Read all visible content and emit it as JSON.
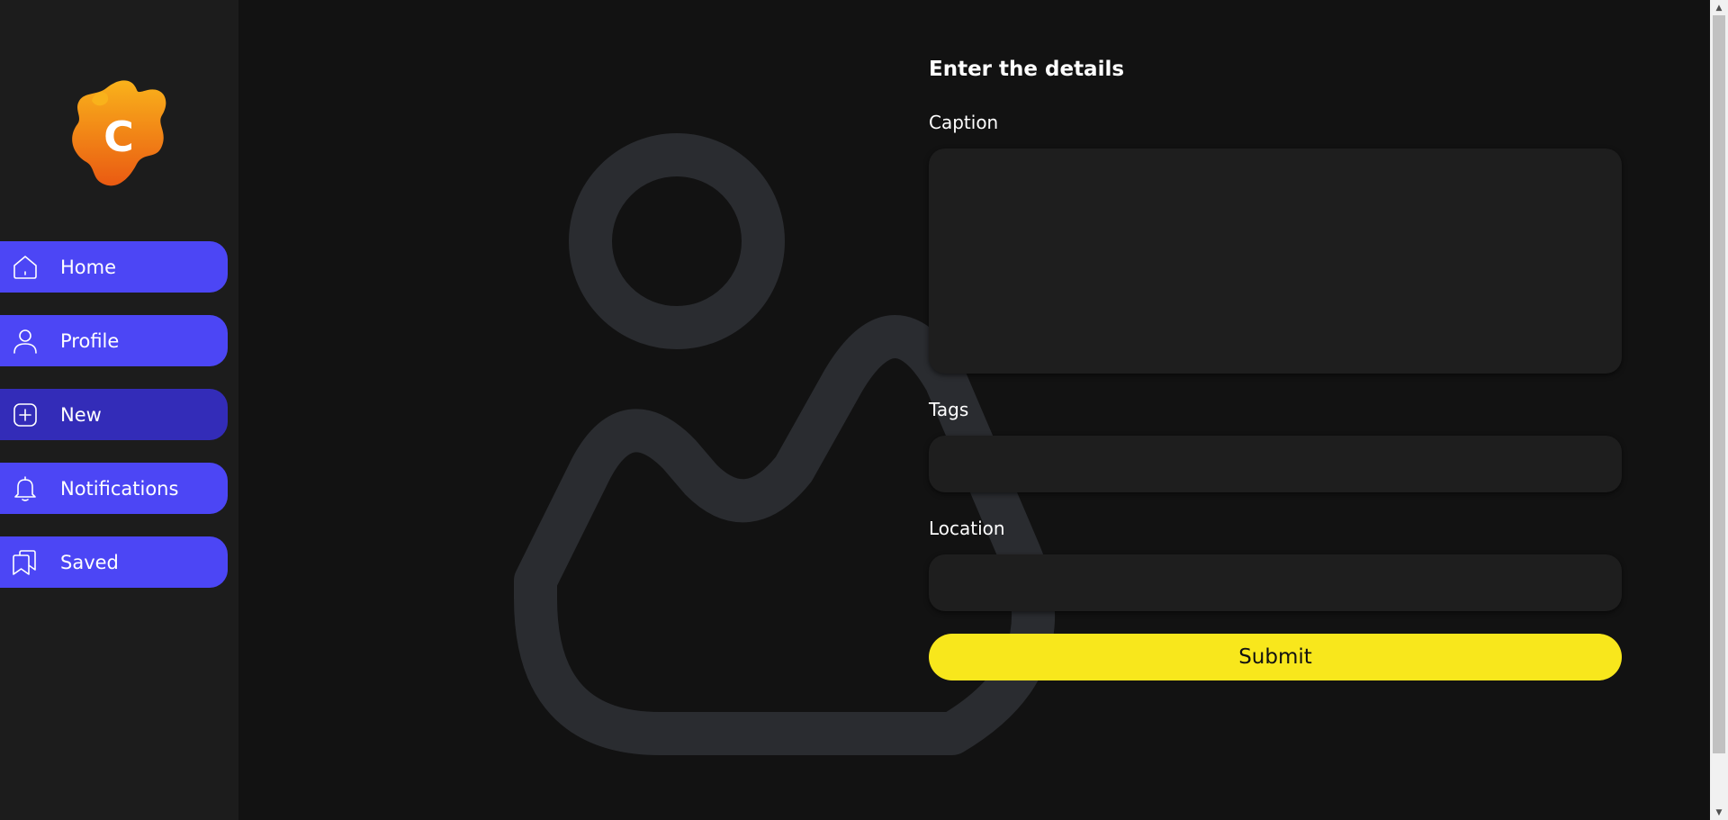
{
  "sidebar": {
    "logo_letter": "C",
    "items": [
      {
        "label": "Home",
        "icon": "home-icon",
        "active": false
      },
      {
        "label": "Profile",
        "icon": "user-icon",
        "active": false
      },
      {
        "label": "New",
        "icon": "plus-square-icon",
        "active": true
      },
      {
        "label": "Notifications",
        "icon": "bell-icon",
        "active": false
      },
      {
        "label": "Saved",
        "icon": "bookmarks-icon",
        "active": false
      }
    ]
  },
  "form": {
    "title": "Enter the details",
    "caption_label": "Caption",
    "caption_value": "",
    "tags_label": "Tags",
    "tags_value": "",
    "location_label": "Location",
    "location_value": "",
    "submit_label": "Submit"
  },
  "colors": {
    "background": "#121212",
    "sidebar": "#1c1c1c",
    "nav_item": "#4c46f5",
    "nav_item_active": "#332cb8",
    "field": "#1e1e1e",
    "submit": "#f8e71c",
    "logo_gradient_top": "#f9b21b",
    "logo_gradient_bottom": "#ea5a12",
    "image_placeholder": "#2a2c30"
  },
  "scrollbar": {
    "up_arrow": "▲",
    "down_arrow": "▼"
  }
}
